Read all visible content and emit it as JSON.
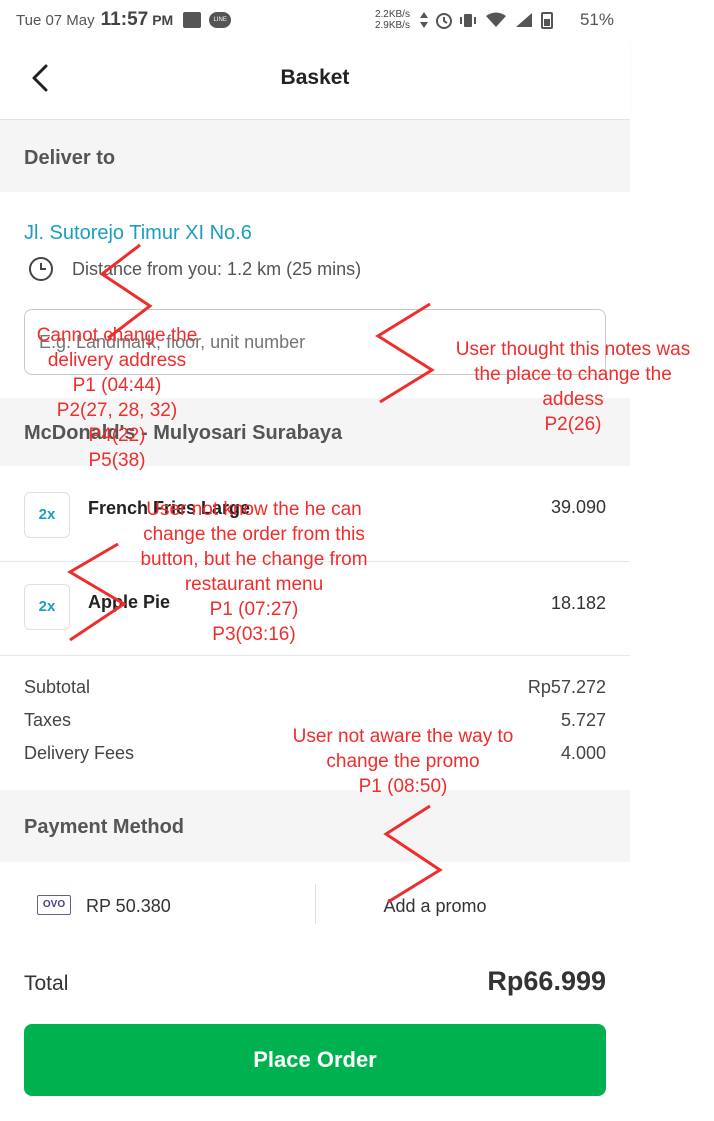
{
  "status_bar": {
    "date": "Tue 07 May",
    "time": "11:57",
    "ampm": "PM",
    "net_up": "2.2KB/s",
    "net_down": "2.9KB/s",
    "battery": "51%",
    "icons": [
      "gallery-icon",
      "line-app-icon",
      "data-arrows-icon",
      "alarm-icon",
      "vibrate-icon",
      "wifi-icon",
      "signal-icon",
      "battery-icon"
    ]
  },
  "header": {
    "title": "Basket",
    "back_icon": "back-arrow-icon"
  },
  "deliver": {
    "section_title": "Deliver to",
    "address": "Jl. Sutorejo Timur XI No.6",
    "distance": "Distance from you: 1.2 km (25 mins)",
    "notes_placeholder": "E.g. Landmark, floor, unit number"
  },
  "restaurant": {
    "name": "McDonald's - Mulyosari Surabaya"
  },
  "items": [
    {
      "qty": "2x",
      "name": "French Fries Large",
      "price": "39.090"
    },
    {
      "qty": "2x",
      "name": "Apple Pie",
      "price": "18.182"
    }
  ],
  "summary": {
    "subtotal_label": "Subtotal",
    "subtotal": "Rp57.272",
    "taxes_label": "Taxes",
    "taxes": "5.727",
    "delivery_label": "Delivery Fees",
    "delivery": "4.000"
  },
  "payment": {
    "section_title": "Payment Method",
    "wallet_logo": "OVO",
    "wallet_amount": "RP 50.380",
    "promo_label": "Add a promo"
  },
  "total": {
    "label": "Total",
    "value": "Rp66.999"
  },
  "place_order": "Place Order",
  "annotations": {
    "address": [
      "Cannot change the",
      "delivery address",
      "P1 (04:44)",
      "P2(27, 28, 32)",
      "P4(22)",
      "P5(38)"
    ],
    "notes": [
      "User thought this notes was",
      "the place to change the",
      "addess",
      "P2(26)"
    ],
    "order": [
      "User not know the he can",
      "change the order from this",
      "button, but he change from",
      "restaurant menu",
      "P1 (07:27)",
      "P3(03:16)"
    ],
    "promo": [
      "User not aware the way to",
      "change the promo",
      "P1 (08:50)"
    ]
  },
  "colors": {
    "accent": "#00b14f",
    "link": "#1a9ec0",
    "annotation": "#ef2d2d",
    "band": "#f5f5f5"
  }
}
